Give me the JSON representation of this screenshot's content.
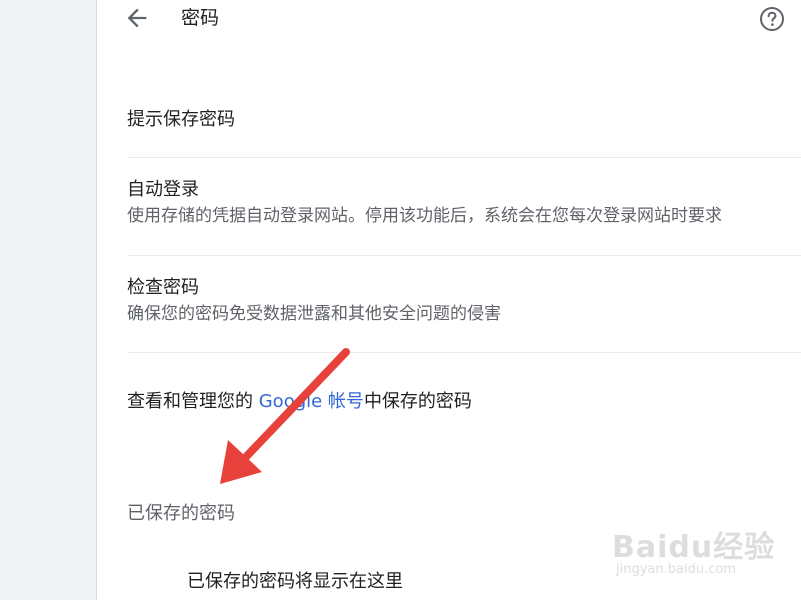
{
  "header": {
    "title": "密码",
    "back_icon": "arrow-left-icon",
    "help_icon": "help-circle-icon"
  },
  "settings": {
    "offer_to_save": {
      "title": "提示保存密码"
    },
    "auto_signin": {
      "title": "自动登录",
      "description": "使用存储的凭据自动登录网站。停用该功能后，系统会在您每次登录网站时要求"
    },
    "check_passwords": {
      "title": "检查密码",
      "description": "确保您的密码免受数据泄露和其他安全问题的侵害"
    }
  },
  "manage": {
    "prefix": "查看和管理您的 ",
    "link": "Google 帐号",
    "suffix": "中保存的密码"
  },
  "saved_passwords": {
    "heading": "已保存的密码",
    "empty_message": "已保存的密码将显示在这里"
  },
  "watermark": {
    "logo": "Baidu经验",
    "url": "jingyan.baidu.com"
  },
  "colors": {
    "link": "#3367d6",
    "annotation_arrow": "#e8413c"
  }
}
